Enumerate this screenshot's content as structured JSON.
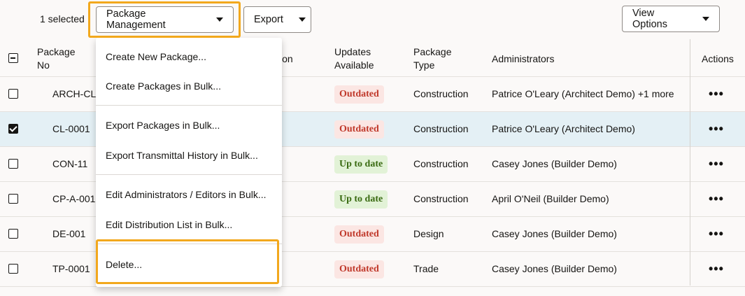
{
  "toolbar": {
    "selected_count": "1 selected",
    "package_management_label": "Package Management",
    "export_label": "Export",
    "view_options_label": "View Options"
  },
  "table": {
    "headers": {
      "package_no": "Package No",
      "description": "ion",
      "updates_available": "Updates Available",
      "package_type": "Package Type",
      "administrators": "Administrators",
      "actions": "Actions"
    },
    "rows": [
      {
        "package_no": "ARCH-CL-",
        "status": "Outdated",
        "status_kind": "outdated",
        "type": "Construction",
        "admins": "Patrice O'Leary (Architect Demo) +1 more",
        "checked": false
      },
      {
        "package_no": "CL-0001",
        "status": "Outdated",
        "status_kind": "outdated",
        "type": "Construction",
        "admins": "Patrice O'Leary (Architect Demo)",
        "checked": true
      },
      {
        "package_no": "CON-11",
        "status": "Up to date",
        "status_kind": "uptodate",
        "type": "Construction",
        "admins": "Casey Jones (Builder Demo)",
        "checked": false
      },
      {
        "package_no": "CP-A-001",
        "status": "Up to date",
        "status_kind": "uptodate",
        "type": "Construction",
        "admins": "April O'Neil (Builder Demo)",
        "checked": false
      },
      {
        "package_no": "DE-001",
        "status": "Outdated",
        "status_kind": "outdated",
        "type": "Design",
        "admins": "Casey Jones (Builder Demo)",
        "checked": false
      },
      {
        "package_no": "TP-0001",
        "status": "Outdated",
        "status_kind": "outdated",
        "type": "Trade",
        "admins": "Casey Jones (Builder Demo)",
        "checked": false
      }
    ],
    "actions_glyph": "•••"
  },
  "menu": {
    "items": [
      "Create New Package...",
      "Create Packages in Bulk...",
      "Export Packages in Bulk...",
      "Export Transmittal History in Bulk...",
      "Edit Administrators / Editors in Bulk...",
      "Edit Distribution List in Bulk...",
      "Delete..."
    ]
  },
  "colors": {
    "highlight": "#f2a81d",
    "selected_row": "#e4f0f5",
    "outdated_text": "#c0392b",
    "outdated_bg": "#fbe6e3",
    "uptodate_text": "#3a6b12",
    "uptodate_bg": "#e2f2d7"
  }
}
